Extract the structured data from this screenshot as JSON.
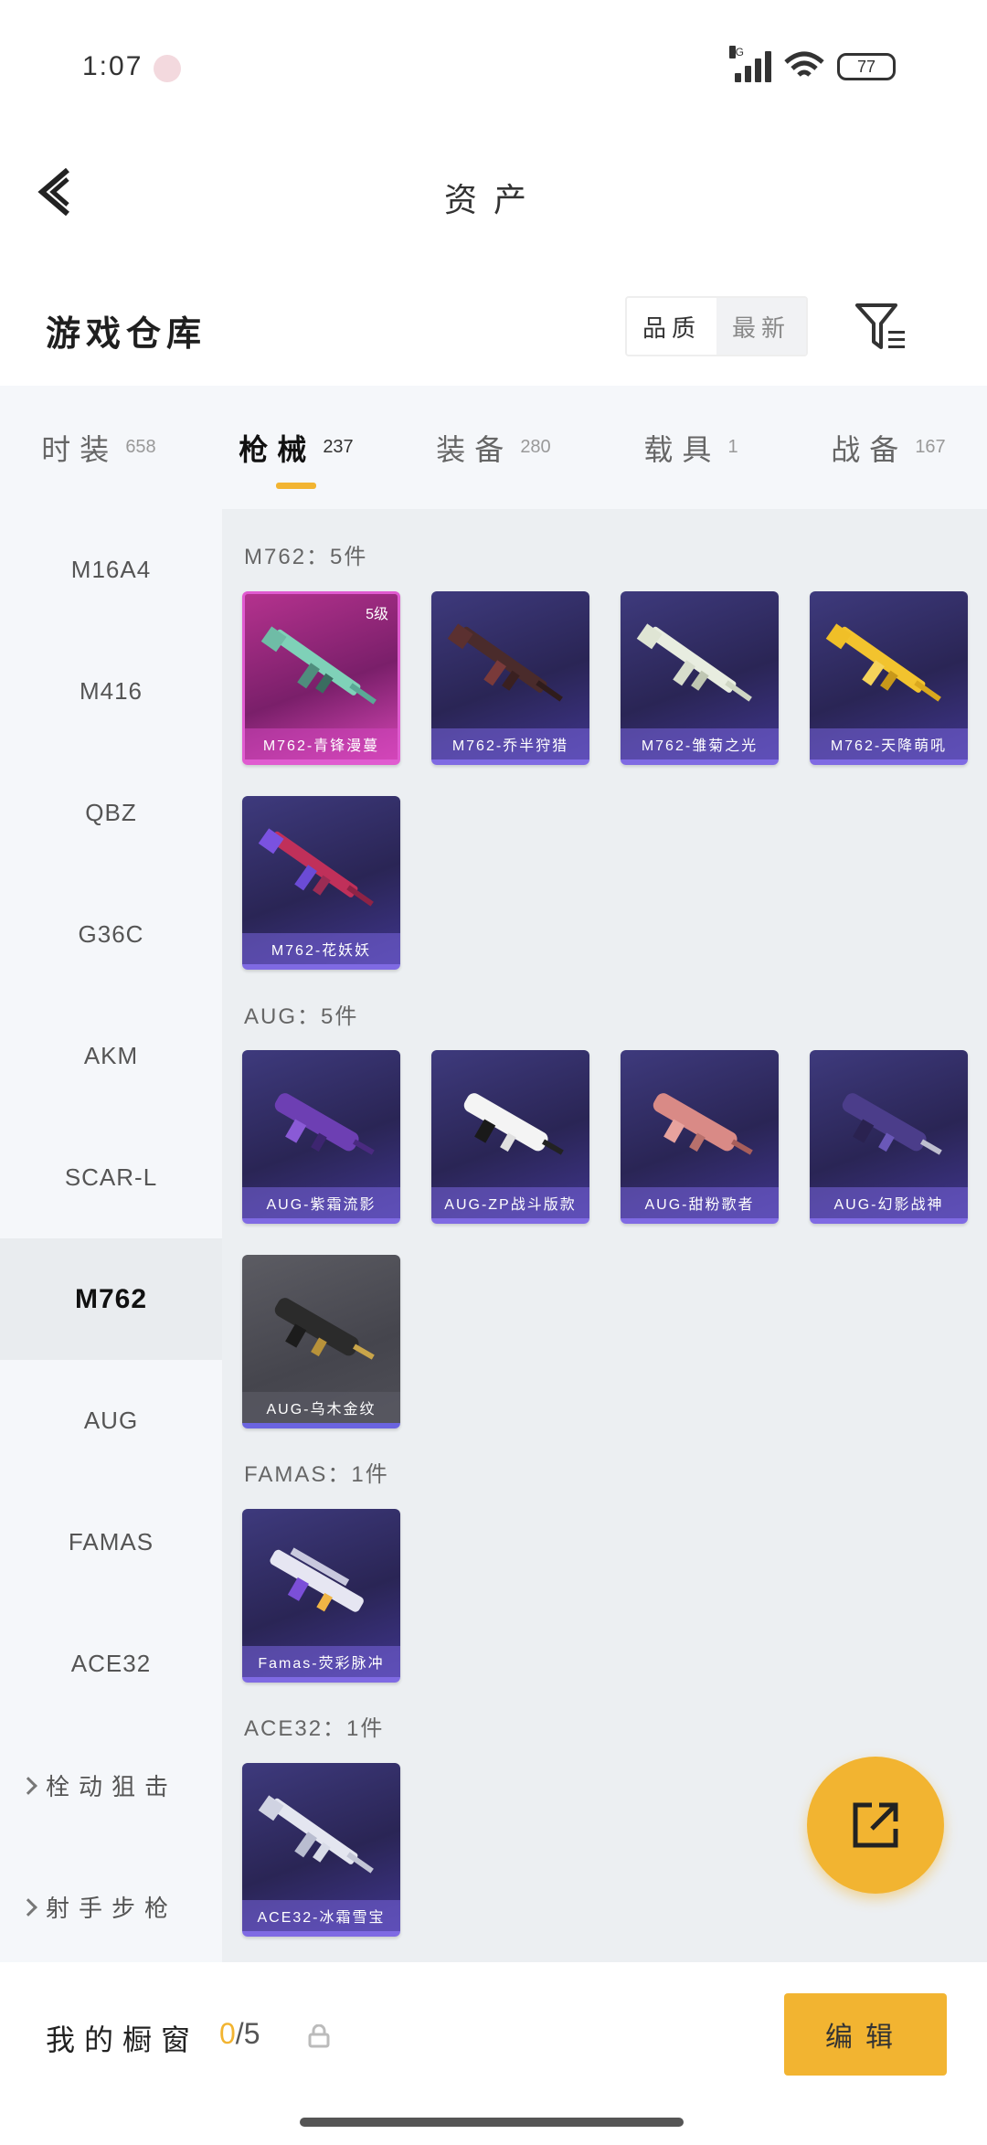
{
  "status_bar": {
    "time": "1:07",
    "network": "5G",
    "battery": "77"
  },
  "header": {
    "title": "资产"
  },
  "subheader": {
    "title": "游戏仓库",
    "sort_options": [
      "品质",
      "最新"
    ],
    "active_sort": "品质"
  },
  "tabs": [
    {
      "label": "时装",
      "count": "658"
    },
    {
      "label": "枪械",
      "count": "237"
    },
    {
      "label": "装备",
      "count": "280"
    },
    {
      "label": "载具",
      "count": "1"
    },
    {
      "label": "战备",
      "count": "167"
    }
  ],
  "sidebar": {
    "items": [
      "M16A4",
      "M416",
      "QBZ",
      "G36C",
      "AKM",
      "SCAR-L",
      "M762",
      "AUG",
      "FAMAS",
      "ACE32"
    ],
    "active": "M762",
    "groups": [
      "栓动狙击",
      "射手步枪"
    ]
  },
  "sections": [
    {
      "label": "M762：5件",
      "items": [
        {
          "name": "M762-青锋漫蔓",
          "level": "5级",
          "rarity": "pink"
        },
        {
          "name": "M762-乔半狩猎",
          "rarity": "purple"
        },
        {
          "name": "M762-雏菊之光",
          "rarity": "purple"
        },
        {
          "name": "M762-天降萌吼",
          "rarity": "purple"
        },
        {
          "name": "M762-花妖妖",
          "rarity": "purple"
        }
      ]
    },
    {
      "label": "AUG：5件",
      "items": [
        {
          "name": "AUG-紫霜流影",
          "rarity": "purple"
        },
        {
          "name": "AUG-ZP战斗版款",
          "rarity": "purple"
        },
        {
          "name": "AUG-甜粉歌者",
          "rarity": "purple"
        },
        {
          "name": "AUG-幻影战神",
          "rarity": "purple"
        },
        {
          "name": "AUG-乌木金纹",
          "rarity": "gray"
        }
      ]
    },
    {
      "label": "FAMAS：1件",
      "items": [
        {
          "name": "Famas-荧彩脉冲",
          "rarity": "purple"
        }
      ]
    },
    {
      "label": "ACE32：1件",
      "items": [
        {
          "name": "ACE32-冰霜雪宝",
          "rarity": "purple"
        }
      ]
    }
  ],
  "bottom_bar": {
    "label": "我的橱窗",
    "current": "0",
    "total": "/5",
    "edit_label": "编辑"
  },
  "colors": {
    "accent": "#f2b431",
    "purple_card": "#3a3479",
    "pink_card": "#b4328e"
  }
}
